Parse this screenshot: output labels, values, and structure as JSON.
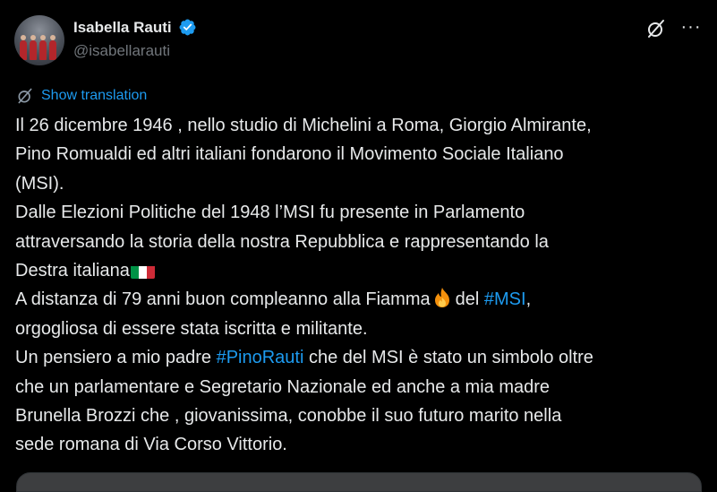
{
  "author": {
    "display_name": "Isabella Rauti",
    "handle": "@isabellarauti",
    "verified": true,
    "avatar_icon": "avatar-photo",
    "verified_icon": "verified-badge-icon"
  },
  "actions": {
    "grok_icon": "grok-icon",
    "more_icon": "more-options-icon",
    "more_glyph": "···"
  },
  "translation": {
    "link_label": "Show translation",
    "icon": "translate-icon"
  },
  "tweet": {
    "lines": [
      "Il 26 dicembre 1946 , nello studio di Michelini a Roma, Giorgio Almirante,",
      "Pino Romualdi ed altri italiani fondarono il Movimento Sociale Italiano",
      "(MSI).",
      "Dalle Elezioni Politiche del 1948 l’MSI fu presente in Parlamento",
      "attraversando la storia della nostra Repubblica e rappresentando la",
      "Destra italiana",
      "A distanza di 79 anni buon compleanno alla Fiamma",
      "del",
      "#MSI",
      ",",
      "orgogliosa di essere stata iscritta e militante.",
      "Un pensiero a mio padre",
      "#PinoRauti",
      "che del MSI è stato un simbolo oltre",
      "che un parlamentare e Segretario Nazionale ed anche a mia madre",
      "Brunella Brozzi  che , giovanissima, conobbe il suo futuro marito nella",
      "sede romana di Via Corso Vittorio."
    ],
    "emoji": {
      "flag": "italy-flag-emoji",
      "fire": "fire-emoji"
    }
  },
  "colors": {
    "background": "#000000",
    "text": "#e7e9ea",
    "secondary_text": "#71767b",
    "accent": "#1d9bf0"
  }
}
